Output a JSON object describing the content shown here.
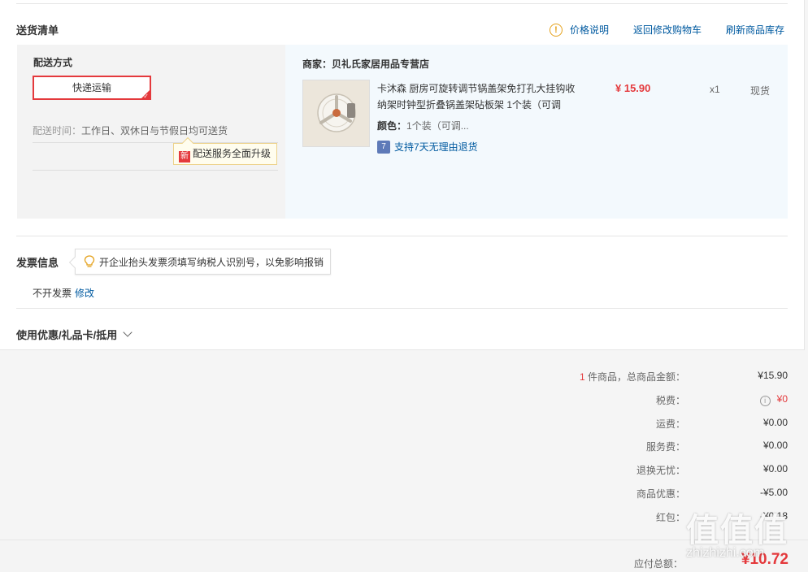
{
  "delivery": {
    "title": "送货清单",
    "links": [
      "价格说明",
      "返回修改购物车",
      "刷新商品库存"
    ],
    "method_label": "配送方式",
    "method_value": "快递运输",
    "time_label": "配送时间：",
    "time_value": "工作日、双休日与节假日均可送货",
    "upgrade_badge": "新",
    "upgrade_text": "配送服务全面升级"
  },
  "shop": {
    "name": "商家：贝礼氏家居用品专营店",
    "product": {
      "title": "卡沐森 厨房可旋转调节锅盖架免打孔大挂钩收纳架时钟型折叠锅盖架砧板架 1个装（可调",
      "color_label": "颜色：",
      "color_value": "1个装（可调...",
      "return_badge": "7",
      "return_text": "支持7天无理由退货",
      "price": "¥ 15.90",
      "qty": "x1",
      "stock": "现货"
    }
  },
  "invoice": {
    "title": "发票信息",
    "tip": "开企业抬头发票须填写纳税人识别号，以免影响报销",
    "value": "不开发票",
    "edit": "修改"
  },
  "coupon": {
    "title": "使用优惠/礼品卡/抵用"
  },
  "summary": {
    "count": "1",
    "count_suffix": " 件商品，总商品金额：",
    "goods_total": "¥15.90",
    "rows": [
      {
        "label": "税费：",
        "value": "¥0"
      },
      {
        "label": "运费：",
        "value": "¥0.00"
      },
      {
        "label": "服务费：",
        "value": "¥0.00"
      },
      {
        "label": "退换无忧：",
        "value": "¥0.00"
      },
      {
        "label": "商品优惠：",
        "value": "-¥5.00"
      },
      {
        "label": "红包：",
        "value": "-¥0.18"
      }
    ],
    "payable_label": "应付总额：",
    "payable_value": "¥10.72"
  },
  "watermark": {
    "glyphs": "值值值",
    "url": "zhizhizhi.com"
  },
  "colors": {
    "accent": "#e4393c",
    "link": "#005aa0"
  }
}
